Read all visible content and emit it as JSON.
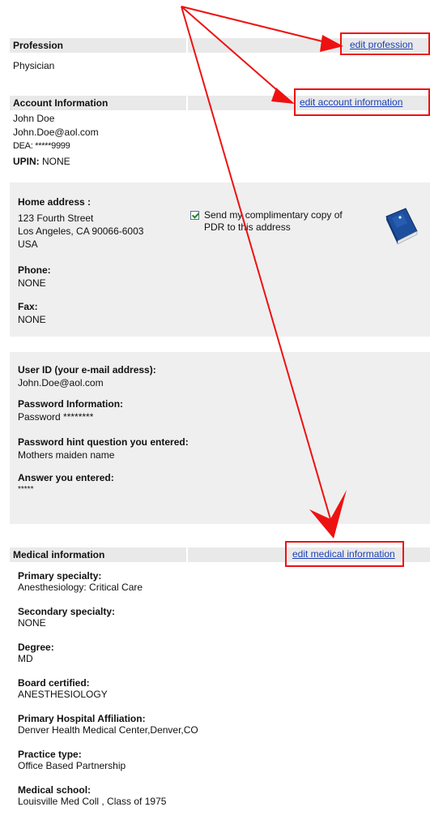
{
  "profession": {
    "header": "Profession",
    "edit_link": "edit profession",
    "value": "Physician"
  },
  "account": {
    "header": "Account Information",
    "edit_link": "edit account information",
    "name": "John Doe",
    "email": "John.Doe@aol.com",
    "dea": "DEA: *****9999",
    "upin_label": "UPIN:",
    "upin_value": "NONE"
  },
  "home": {
    "address_label": "Home address :",
    "street": "123 Fourth Street",
    "city_line": "Los Angeles,  CA  90066-6003",
    "country": "USA",
    "send_copy_checked": true,
    "send_copy_text_1": "Send my complimentary copy of",
    "send_copy_text_2": "PDR to this address",
    "book_icon": "book-icon",
    "phone_label": "Phone:",
    "phone_value": "NONE",
    "fax_label": "Fax:",
    "fax_value": "NONE"
  },
  "login": {
    "userid_label": "User ID (your e-mail address):",
    "userid_value": "John.Doe@aol.com",
    "password_label": "Password Information:",
    "password_value": "Password  ********",
    "hint_label": "Password hint question you entered:",
    "hint_value": "Mothers maiden name",
    "answer_label": "Answer you entered:",
    "answer_value": "*****"
  },
  "medical": {
    "header": "Medical information",
    "edit_link": "edit medical information",
    "fields": [
      {
        "label": "Primary specialty:",
        "value": "Anesthesiology: Critical Care"
      },
      {
        "label": "Secondary specialty:",
        "value": "NONE"
      },
      {
        "label": "Degree:",
        "value": "MD"
      },
      {
        "label": "Board certified:",
        "value": "ANESTHESIOLOGY"
      },
      {
        "label": "Primary Hospital Affiliation:",
        "value": "Denver Health Medical Center,Denver,CO"
      },
      {
        "label": "Practice type:",
        "value": "Office Based Partnership"
      },
      {
        "label": "Medical school:",
        "value": "Louisville Med Coll , Class of 1975"
      }
    ]
  },
  "colors": {
    "annotation_red": "#ee1111",
    "link_blue": "#1a3fb5",
    "header_gray": "#e9e9e9",
    "panel_gray": "#efefef"
  }
}
